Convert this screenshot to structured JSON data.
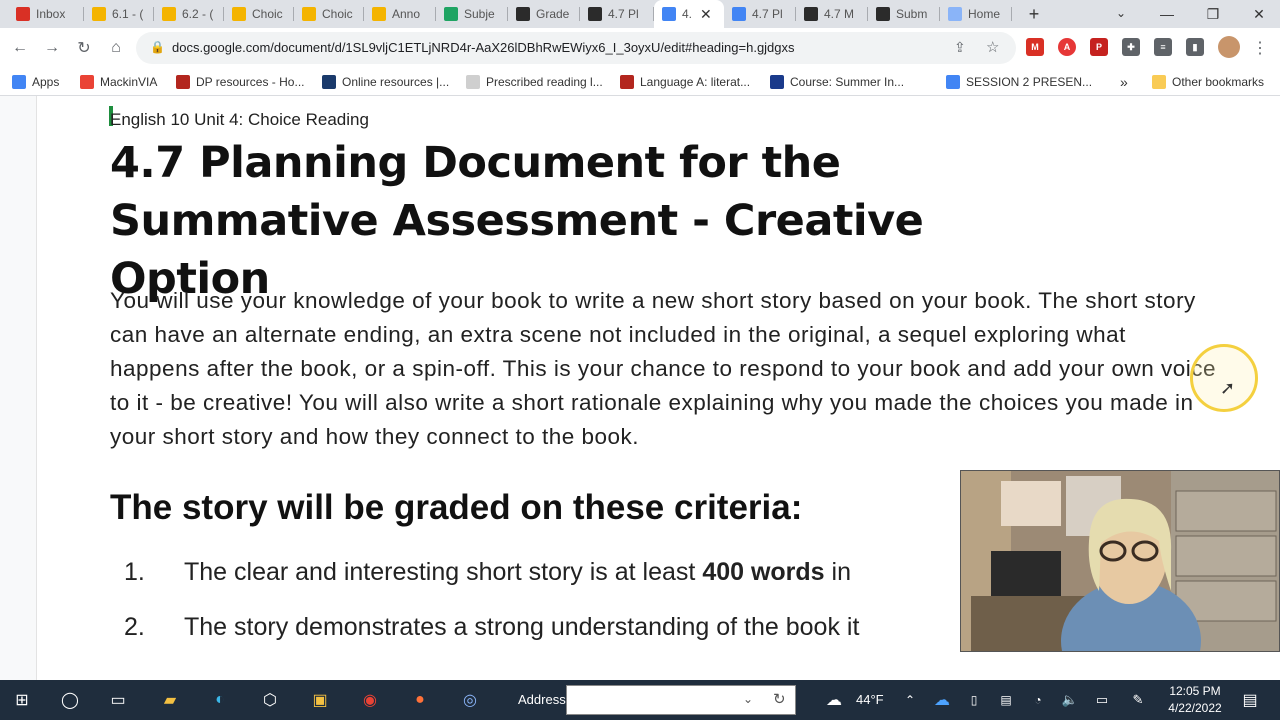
{
  "browser": {
    "tabs": [
      {
        "label": "Inbox",
        "icon": "gmail-icon",
        "color": "#d93025"
      },
      {
        "label": "6.1 - (",
        "icon": "slides-icon",
        "color": "#f4b400"
      },
      {
        "label": "6.2 - (",
        "icon": "slides-icon",
        "color": "#f4b400"
      },
      {
        "label": "Choic",
        "icon": "slides-icon",
        "color": "#f4b400"
      },
      {
        "label": "Choic",
        "icon": "slides-icon",
        "color": "#f4b400"
      },
      {
        "label": "Anno",
        "icon": "slides-icon",
        "color": "#f4b400"
      },
      {
        "label": "Subje",
        "icon": "drive-icon",
        "color": "#1fa463"
      },
      {
        "label": "Grade",
        "icon": "schoology-icon",
        "color": "#2b2b2b"
      },
      {
        "label": "4.7 Pl",
        "icon": "schoology-icon",
        "color": "#2b2b2b"
      },
      {
        "label": "4.",
        "icon": "docs-icon",
        "color": "#4285f4"
      },
      {
        "label": "4.7 Pl",
        "icon": "docs-icon",
        "color": "#4285f4"
      },
      {
        "label": "4.7 M",
        "icon": "schoology-icon",
        "color": "#2b2b2b"
      },
      {
        "label": "Subm",
        "icon": "schoology-icon",
        "color": "#2b2b2b"
      },
      {
        "label": "Home",
        "icon": "circle-icon",
        "color": "#8ab4f8"
      }
    ],
    "new_tab": "+",
    "url": "docs.google.com/document/d/1SL9vljC1ETLjNRD4r-AaX26lDBhRwEWiyx6_I_3oyxU/edit#heading=h.gjdgxs",
    "bookmarks": [
      {
        "label": "Apps",
        "icon": "apps-grid-icon",
        "color": "#4285f4"
      },
      {
        "label": "MackinVIA",
        "icon": "google-icon",
        "color": "#ea4335"
      },
      {
        "label": "DP resources - Ho...",
        "icon": "pr-icon",
        "color": "#b3261e"
      },
      {
        "label": "Online resources |...",
        "icon": "h-icon",
        "color": "#1a3a6b"
      },
      {
        "label": "Prescribed reading l...",
        "icon": "circle-icon",
        "color": "#cfcfcf"
      },
      {
        "label": "Language A: literat...",
        "icon": "pr-icon",
        "color": "#b3261e"
      },
      {
        "label": "Course: Summer In...",
        "icon": "mcp-icon",
        "color": "#1a3a8b"
      },
      {
        "label": "SESSION 2 PRESEN...",
        "icon": "docs-icon",
        "color": "#4285f4"
      }
    ],
    "more_bookmarks": "»",
    "other_bookmarks": "Other bookmarks"
  },
  "document": {
    "course_heading": "English 10 Unit 4: Choice Reading",
    "title": "4.7 Planning Document for the Summative Assessment - Creative Option",
    "intro_paragraph": "You will use your knowledge of your book to write a new short story based on your book. The short story can have an alternate ending, an extra scene not included in the original, a sequel exploring what happens after the book, or a spin-off. This is your chance to respond to your book and add your own voice to it - be creative! You will also write a short rationale explaining why you made the choices you made in your short story and how they connect to the book.",
    "criteria_heading": "The story will be graded on these criteria:",
    "criteria": [
      {
        "num": "1.",
        "pre": "The clear and interesting short story is at least ",
        "bold": "400 words",
        "post": " in"
      },
      {
        "num": "2.",
        "pre": "The story demonstrates a strong understanding of the book it",
        "bold": "",
        "post": ""
      }
    ]
  },
  "taskbar": {
    "address_label": "Address",
    "temperature": "44°F",
    "time": "12:05 PM",
    "date": "4/22/2022"
  }
}
